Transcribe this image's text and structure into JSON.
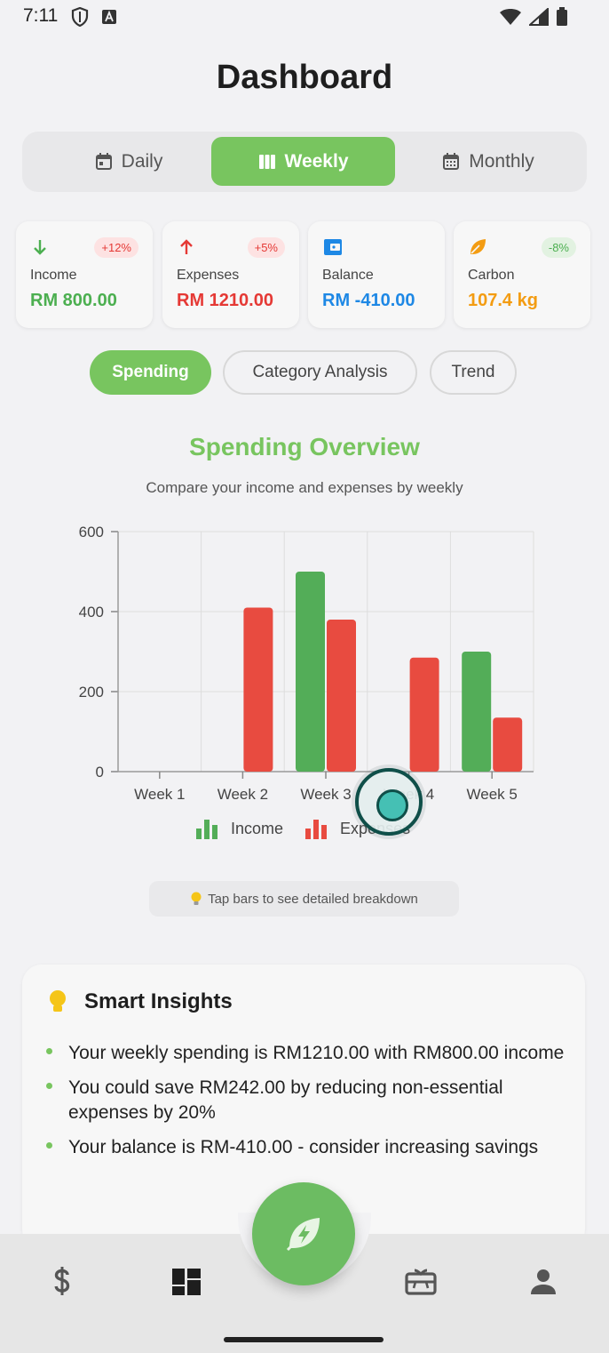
{
  "status_bar": {
    "time": "7:11"
  },
  "header": {
    "title": "Dashboard"
  },
  "period_tabs": [
    {
      "label": "Daily",
      "icon": "calendar-day-icon",
      "active": false
    },
    {
      "label": "Weekly",
      "icon": "columns-icon",
      "active": true
    },
    {
      "label": "Monthly",
      "icon": "calendar-month-icon",
      "active": false
    }
  ],
  "stats": [
    {
      "label": "Income",
      "value": "RM 800.00",
      "badge": "+12%",
      "icon": "arrow-down-icon",
      "color": "#4caf50"
    },
    {
      "label": "Expenses",
      "value": "RM 1210.00",
      "badge": "+5%",
      "icon": "arrow-up-icon",
      "color": "#e53935"
    },
    {
      "label": "Balance",
      "value": "RM -410.00",
      "badge": "",
      "icon": "wallet-icon",
      "color": "#1e88e5"
    },
    {
      "label": "Carbon",
      "value": "107.4 kg",
      "badge": "-8%",
      "icon": "leaf-icon",
      "color": "#f39c12"
    }
  ],
  "view_tabs": [
    {
      "label": "Spending",
      "active": true
    },
    {
      "label": "Category Analysis",
      "active": false
    },
    {
      "label": "Trend",
      "active": false
    }
  ],
  "chart_section": {
    "title": "Spending Overview",
    "subtitle": "Compare your income and expenses by weekly",
    "tip": "Tap bars to see detailed breakdown"
  },
  "chart_data": {
    "type": "bar",
    "categories": [
      "Week 1",
      "Week 2",
      "Week 3",
      "Week 4",
      "Week 5"
    ],
    "series": [
      {
        "name": "Income",
        "color": "#53ad58",
        "values": [
          0,
          0,
          500,
          0,
          300
        ]
      },
      {
        "name": "Expenses",
        "color": "#e84b40",
        "values": [
          0,
          410,
          380,
          285,
          135
        ]
      }
    ],
    "ylim": [
      0,
      600
    ],
    "yticks": [
      0,
      200,
      400,
      600
    ],
    "grid": true,
    "legend": "bottom"
  },
  "insights": {
    "title": "Smart Insights",
    "items": [
      "Your weekly spending is RM1210.00 with RM800.00 income",
      "You could save RM242.00 by reducing non-essential expenses by 20%",
      "Your balance is RM-410.00 - consider increasing savings"
    ]
  },
  "bottom_nav": [
    {
      "icon": "dollar-icon"
    },
    {
      "icon": "dashboard-icon",
      "active": true
    },
    {
      "icon": "eco-action-icon"
    },
    {
      "icon": "gift-card-icon"
    },
    {
      "icon": "person-icon"
    }
  ]
}
